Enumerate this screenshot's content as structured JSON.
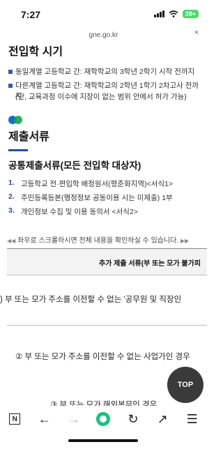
{
  "status": {
    "time": "7:27",
    "battery": "38+"
  },
  "url": {
    "domain": "gne.go.kr",
    "close": "×"
  },
  "section1": {
    "title": "전입학 시기",
    "bullets": [
      "동일계열 고등학교 간: 재학학교의 3학년 2학기 시작 전까지",
      "다른계열 고등학교 간: 재학학교의 2학년 1학기 2차고사 전까지",
      "(단, 교육과정 이수에 지장이 없는 범위 안에서 허가 가능)"
    ]
  },
  "section2": {
    "title": "제출서류",
    "subtitle": "공통제출서류(모든 전입학 대상자)",
    "items": [
      {
        "num": "1.",
        "text": "고등학교 전·편입학 배정원서(평준화지역)<서식1>"
      },
      {
        "num": "2.",
        "text": "주민등록등본(행정정보 공동이용 시는 미제출) 1부"
      },
      {
        "num": "3.",
        "text": "개인정보 수집 및 이용 동의서 <서식2>"
      }
    ]
  },
  "table": {
    "scroll_hint": "좌우로 스크롤하시면 전체 내용을 확인하실 수 있습니다.",
    "header": "추가 제출 서류(부 또는 모가 불가피",
    "row1": ") 부 또는 모가 주소를 이전할 수 없는 '공무원 및 직장인",
    "row2": "② 부 또는 모가 주소를 이전할 수 없는 사업가인 경우",
    "row3": "③ 부 또는 모가 해외복무인 경우"
  },
  "fab": {
    "top_label": "TOP",
    "up_arrow": "↑"
  },
  "toolbar": {
    "n_label": "N",
    "back": "←",
    "forward": "→",
    "refresh": "↻",
    "share": "↗",
    "menu": "☰"
  }
}
